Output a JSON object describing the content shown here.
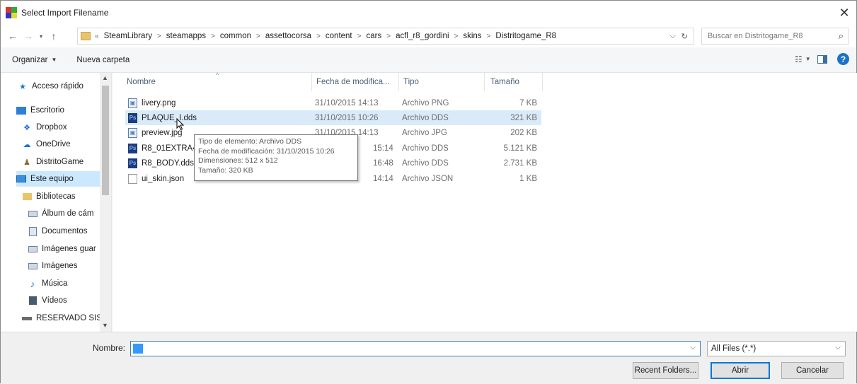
{
  "window": {
    "title": "Select Import Filename"
  },
  "address": {
    "prefix": "«",
    "crumbs": [
      "SteamLibrary",
      "steamapps",
      "common",
      "assettocorsa",
      "content",
      "cars",
      "acfl_r8_gordini",
      "skins",
      "Distritogame_R8"
    ],
    "separator": ">"
  },
  "search": {
    "placeholder": "Buscar en Distritogame_R8"
  },
  "toolbar": {
    "organize": "Organizar",
    "new_folder": "Nueva carpeta"
  },
  "nav": {
    "items": [
      {
        "label": "Acceso rápido",
        "icon": "star-icon"
      },
      {
        "label": "Escritorio",
        "icon": "desktop-icon"
      },
      {
        "label": "Dropbox",
        "icon": "dropbox-icon"
      },
      {
        "label": "OneDrive",
        "icon": "onedrive-icon"
      },
      {
        "label": "DistritoGame",
        "icon": "user-icon"
      },
      {
        "label": "Este equipo",
        "icon": "computer-icon"
      },
      {
        "label": "Bibliotecas",
        "icon": "library-icon"
      },
      {
        "label": "Álbum de cám",
        "icon": "pictures-icon"
      },
      {
        "label": "Documentos",
        "icon": "documents-icon"
      },
      {
        "label": "Imágenes guar",
        "icon": "pictures-icon"
      },
      {
        "label": "Imágenes",
        "icon": "pictures-icon"
      },
      {
        "label": "Música",
        "icon": "music-icon"
      },
      {
        "label": "Vídeos",
        "icon": "videos-icon"
      },
      {
        "label": "RESERVADO SIST",
        "icon": "drive-icon"
      }
    ]
  },
  "columns": {
    "name": "Nombre",
    "date": "Fecha de modifica...",
    "type": "Tipo",
    "size": "Tamaño"
  },
  "files": [
    {
      "name": "livery.png",
      "date": "31/10/2015 14:13",
      "type": "Archivo PNG",
      "size": "7 KB",
      "icon": "image-file-icon"
    },
    {
      "name": "PLAQUE_I.dds",
      "date": "31/10/2015 10:26",
      "type": "Archivo DDS",
      "size": "321 KB",
      "icon": "dds-file-icon"
    },
    {
      "name": "preview.jpg",
      "date": "31/10/2015 14:13",
      "type": "Archivo JPG",
      "size": "202 KB",
      "icon": "image-file-icon"
    },
    {
      "name": "R8_01EXTRA4",
      "date": "15:14",
      "type": "Archivo DDS",
      "size": "5.121 KB",
      "icon": "dds-file-icon"
    },
    {
      "name": "R8_BODY.dds",
      "date": "16:48",
      "type": "Archivo DDS",
      "size": "2.731 KB",
      "icon": "dds-file-icon"
    },
    {
      "name": "ui_skin.json",
      "date": "14:14",
      "type": "Archivo JSON",
      "size": "1 KB",
      "icon": "document-file-icon"
    }
  ],
  "tooltip": {
    "line1": "Tipo de elemento: Archivo DDS",
    "line2": "Fecha de modificación: 31/10/2015 10:26",
    "line3": "Dimensiones: 512 x 512",
    "line4": "Tamaño: 320 KB"
  },
  "bottom": {
    "name_label": "Nombre:",
    "filename_value": "",
    "filter": "All Files (*.*)",
    "recent_button": "Recent Folders...",
    "open_button": "Abrir",
    "cancel_button": "Cancelar"
  }
}
